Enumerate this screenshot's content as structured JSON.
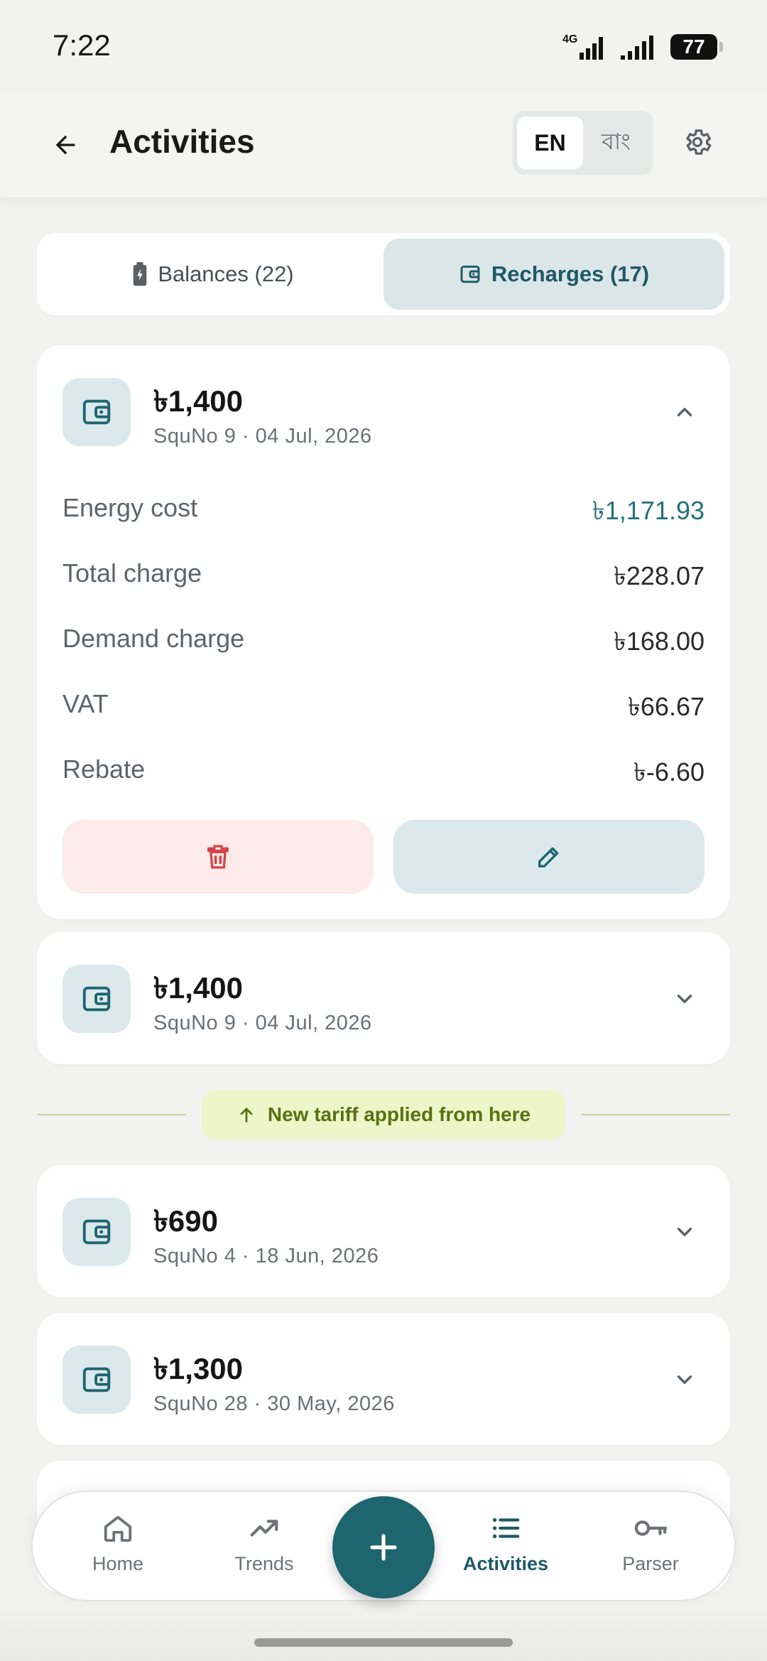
{
  "status_bar": {
    "time": "7:22",
    "network": "4G",
    "battery": "77"
  },
  "header": {
    "title": "Activities",
    "lang_en": "EN",
    "lang_bn": "বাং"
  },
  "segments": {
    "balances_label": "Balances (22)",
    "recharges_label": "Recharges (17)"
  },
  "recharges": [
    {
      "amount": "৳1,400",
      "meta": "SquNo 9 · 04 Jul, 2026",
      "expanded": true,
      "details": [
        {
          "label": "Energy cost",
          "value": "৳1,171.93"
        },
        {
          "label": "Total charge",
          "value": "৳228.07"
        },
        {
          "label": "Demand charge",
          "value": "৳168.00"
        },
        {
          "label": "VAT",
          "value": "৳66.67"
        },
        {
          "label": "Rebate",
          "value": "৳-6.60"
        }
      ]
    },
    {
      "amount": "৳1,400",
      "meta": "SquNo 9 · 04 Jul, 2026",
      "expanded": false
    },
    {
      "amount": "৳690",
      "meta": "SquNo 4 · 18 Jun, 2026",
      "expanded": false
    },
    {
      "amount": "৳1,300",
      "meta": "SquNo 28 · 30 May, 2026",
      "expanded": false
    }
  ],
  "tariff_notice": "New tariff applied from here",
  "nav": {
    "home": "Home",
    "trends": "Trends",
    "activities": "Activities",
    "parser": "Parser"
  },
  "colors": {
    "accent": "#1e6570",
    "accent_soft": "#dbe9ec",
    "danger": "#d64545",
    "tariff": "#5a7012"
  }
}
